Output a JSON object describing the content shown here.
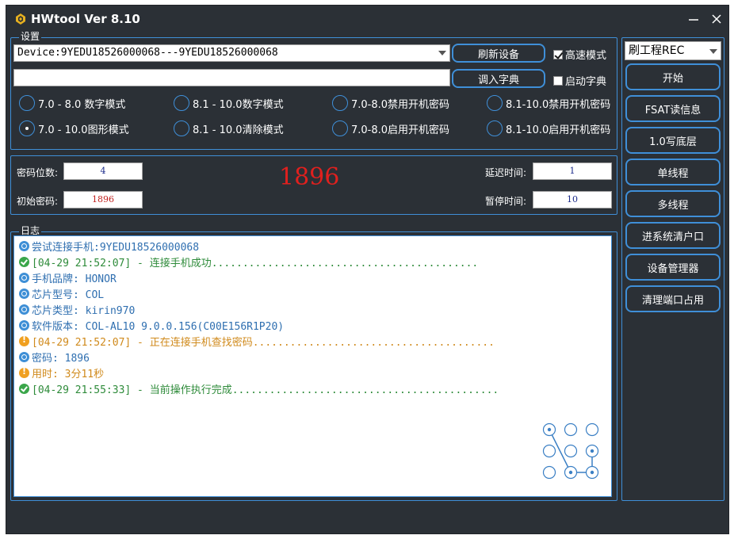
{
  "window": {
    "title": "HWtool Ver 8.10"
  },
  "settings": {
    "legend": "设置",
    "device_combo": "Device:9YEDU18526000068---9YEDU18526000068",
    "dict_path": "",
    "refresh_button": "刷新设备",
    "load_dict_button": "调入字典",
    "high_speed_label": "高速模式",
    "high_speed_checked": true,
    "enable_dict_label": "启动字典",
    "enable_dict_checked": false,
    "modes": [
      {
        "label": "7.0 - 8.0  数字模式",
        "selected": false
      },
      {
        "label": "8.1 - 10.0数字模式",
        "selected": false
      },
      {
        "label": "7.0-8.0禁用开机密码",
        "selected": false
      },
      {
        "label": "8.1-10.0禁用开机密码",
        "selected": false
      },
      {
        "label": "7.0 - 10.0图形模式",
        "selected": true
      },
      {
        "label": "8.1 - 10.0清除模式",
        "selected": false
      },
      {
        "label": "7.0-8.0启用开机密码",
        "selected": false
      },
      {
        "label": "8.1-10.0启用开机密码",
        "selected": false
      }
    ]
  },
  "params": {
    "digits_label": "密码位数:",
    "digits_value": "4",
    "initial_label": "初始密码:",
    "initial_value": "1896",
    "result": "1896",
    "delay_label": "延迟时间:",
    "delay_value": "1",
    "pause_label": "暂停时间:",
    "pause_value": "10"
  },
  "log": {
    "legend": "日志",
    "lines": [
      {
        "type": "info",
        "color": "blue",
        "text": "尝试连接手机:9YEDU18526000068"
      },
      {
        "type": "ok",
        "color": "green",
        "text": "[04-29 21:52:07] - 连接手机成功..........................................."
      },
      {
        "type": "info",
        "color": "blue",
        "text": "手机品牌: HONOR"
      },
      {
        "type": "info",
        "color": "blue",
        "text": "芯片型号: COL"
      },
      {
        "type": "info",
        "color": "blue",
        "text": "芯片类型: kirin970"
      },
      {
        "type": "info",
        "color": "blue",
        "text": "软件版本: COL-AL10 9.0.0.156(C00E156R1P20)"
      },
      {
        "type": "warn",
        "color": "orange",
        "text": "[04-29 21:52:07] - 正在连接手机查找密码......................................."
      },
      {
        "type": "info",
        "color": "blue",
        "text": "密码: 1896"
      },
      {
        "type": "warn",
        "color": "orange",
        "text": "用时: 3分11秒"
      },
      {
        "type": "ok",
        "color": "green",
        "text": "[04-29 21:55:33] - 当前操作执行完成..........................................."
      }
    ],
    "pattern_sequence": [
      1,
      8,
      9,
      6
    ]
  },
  "side": {
    "mode_combo": "刷工程REC",
    "buttons": [
      "开始",
      "FSAT读信息",
      "1.0写底层",
      "单线程",
      "多线程",
      "进系统清户口",
      "设备管理器",
      "清理端口占用"
    ]
  },
  "colors": {
    "background": "#2b3036",
    "accent": "#3f8fd8",
    "result_red": "#e0201e"
  }
}
